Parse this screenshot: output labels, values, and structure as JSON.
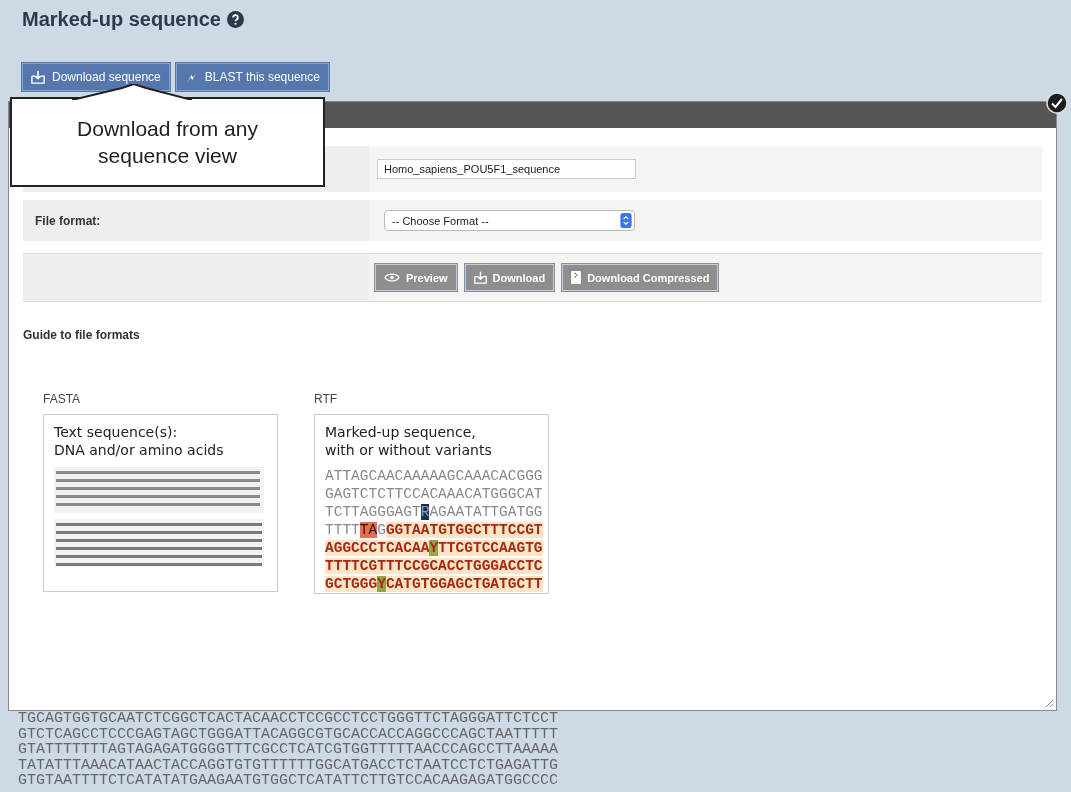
{
  "title": "Marked-up sequence",
  "toolbar": [
    {
      "label": "Download sequence",
      "kind": "download"
    },
    {
      "label": "BLAST this sequence",
      "kind": "blast"
    }
  ],
  "callout": {
    "text": "Download from any sequence view"
  },
  "form": {
    "filename": {
      "value": "Homo_sapiens_POU5F1_sequence"
    },
    "format": {
      "label": "File format:",
      "value": "-- Choose Format --"
    },
    "buttons": [
      {
        "label": "Preview",
        "kind": "preview"
      },
      {
        "label": "Download",
        "kind": "download"
      },
      {
        "label": "Download Compressed",
        "kind": "compressed"
      }
    ]
  },
  "guide": {
    "heading": "Guide to file formats",
    "formats": [
      {
        "name": "FASTA",
        "kind": "fasta",
        "caption": [
          "Text sequence(s):",
          "DNA and/or amino acids"
        ]
      },
      {
        "name": "RTF",
        "kind": "rtf",
        "caption": [
          "Marked-up sequence,",
          "with or without variants"
        ],
        "lines": [
          [
            {
              "text": "ATTAGCAACAAAAAGCAAACACGGG",
              "kind": "plain"
            }
          ],
          [
            {
              "text": "GAGTCTCTTCCACAAACATGGGCAT",
              "kind": "plain"
            }
          ],
          [
            {
              "text": "TCTTAGGGAGT",
              "kind": "plain"
            },
            {
              "text": "R",
              "kind": "variant"
            },
            {
              "text": "AGAATATTGATGG",
              "kind": "plain"
            }
          ],
          [
            {
              "text": "TTTT",
              "kind": "plain"
            },
            {
              "text": "TA",
              "kind": "marked"
            },
            {
              "text": "G",
              "kind": "plain"
            },
            {
              "text": "GGTAATGTGGCTTTCCGT",
              "kind": "exon"
            }
          ],
          [
            {
              "text": "AGGCCCTCACAA",
              "kind": "exon"
            },
            {
              "text": "Y",
              "kind": "snp"
            },
            {
              "text": "TTCGTCCAAGTG",
              "kind": "exon"
            }
          ],
          [
            {
              "text": "TTTTCGTTTCCGCACCTGGGACCTC",
              "kind": "exon"
            }
          ],
          [
            {
              "text": "GCTGGG",
              "kind": "exon"
            },
            {
              "text": "Y",
              "kind": "snp"
            },
            {
              "text": "CATGTGGAGCTGATGCTT",
              "kind": "exon"
            }
          ]
        ]
      }
    ]
  },
  "background_sequence": [
    "TGCAGTGGTGCAATCTCGGCTCACTACAACCTCCGCCTCCTGGGTTCTAGGGATTCTCCT",
    "GTCTCAGCCTCCCGAGTAGCTGGGATTACAGGCGTGCACCACCAGGCCCAGCTAATTTTT",
    "GTATTTTTTTAGTAGAGATGGGGTTTCGCCTCATCGTGGTTTTTAACCCAGCCTTAAAAA",
    "TATATTTAAACATAACTACCAGGTGTGTTTTTTGGCATGACCTCTAATCCTCTGAGATTG",
    "GTGTAATTTTCTCATATATGAAGAATGTGGCTCATATTCTTGTCCACAAGAGATGGCCCC"
  ]
}
